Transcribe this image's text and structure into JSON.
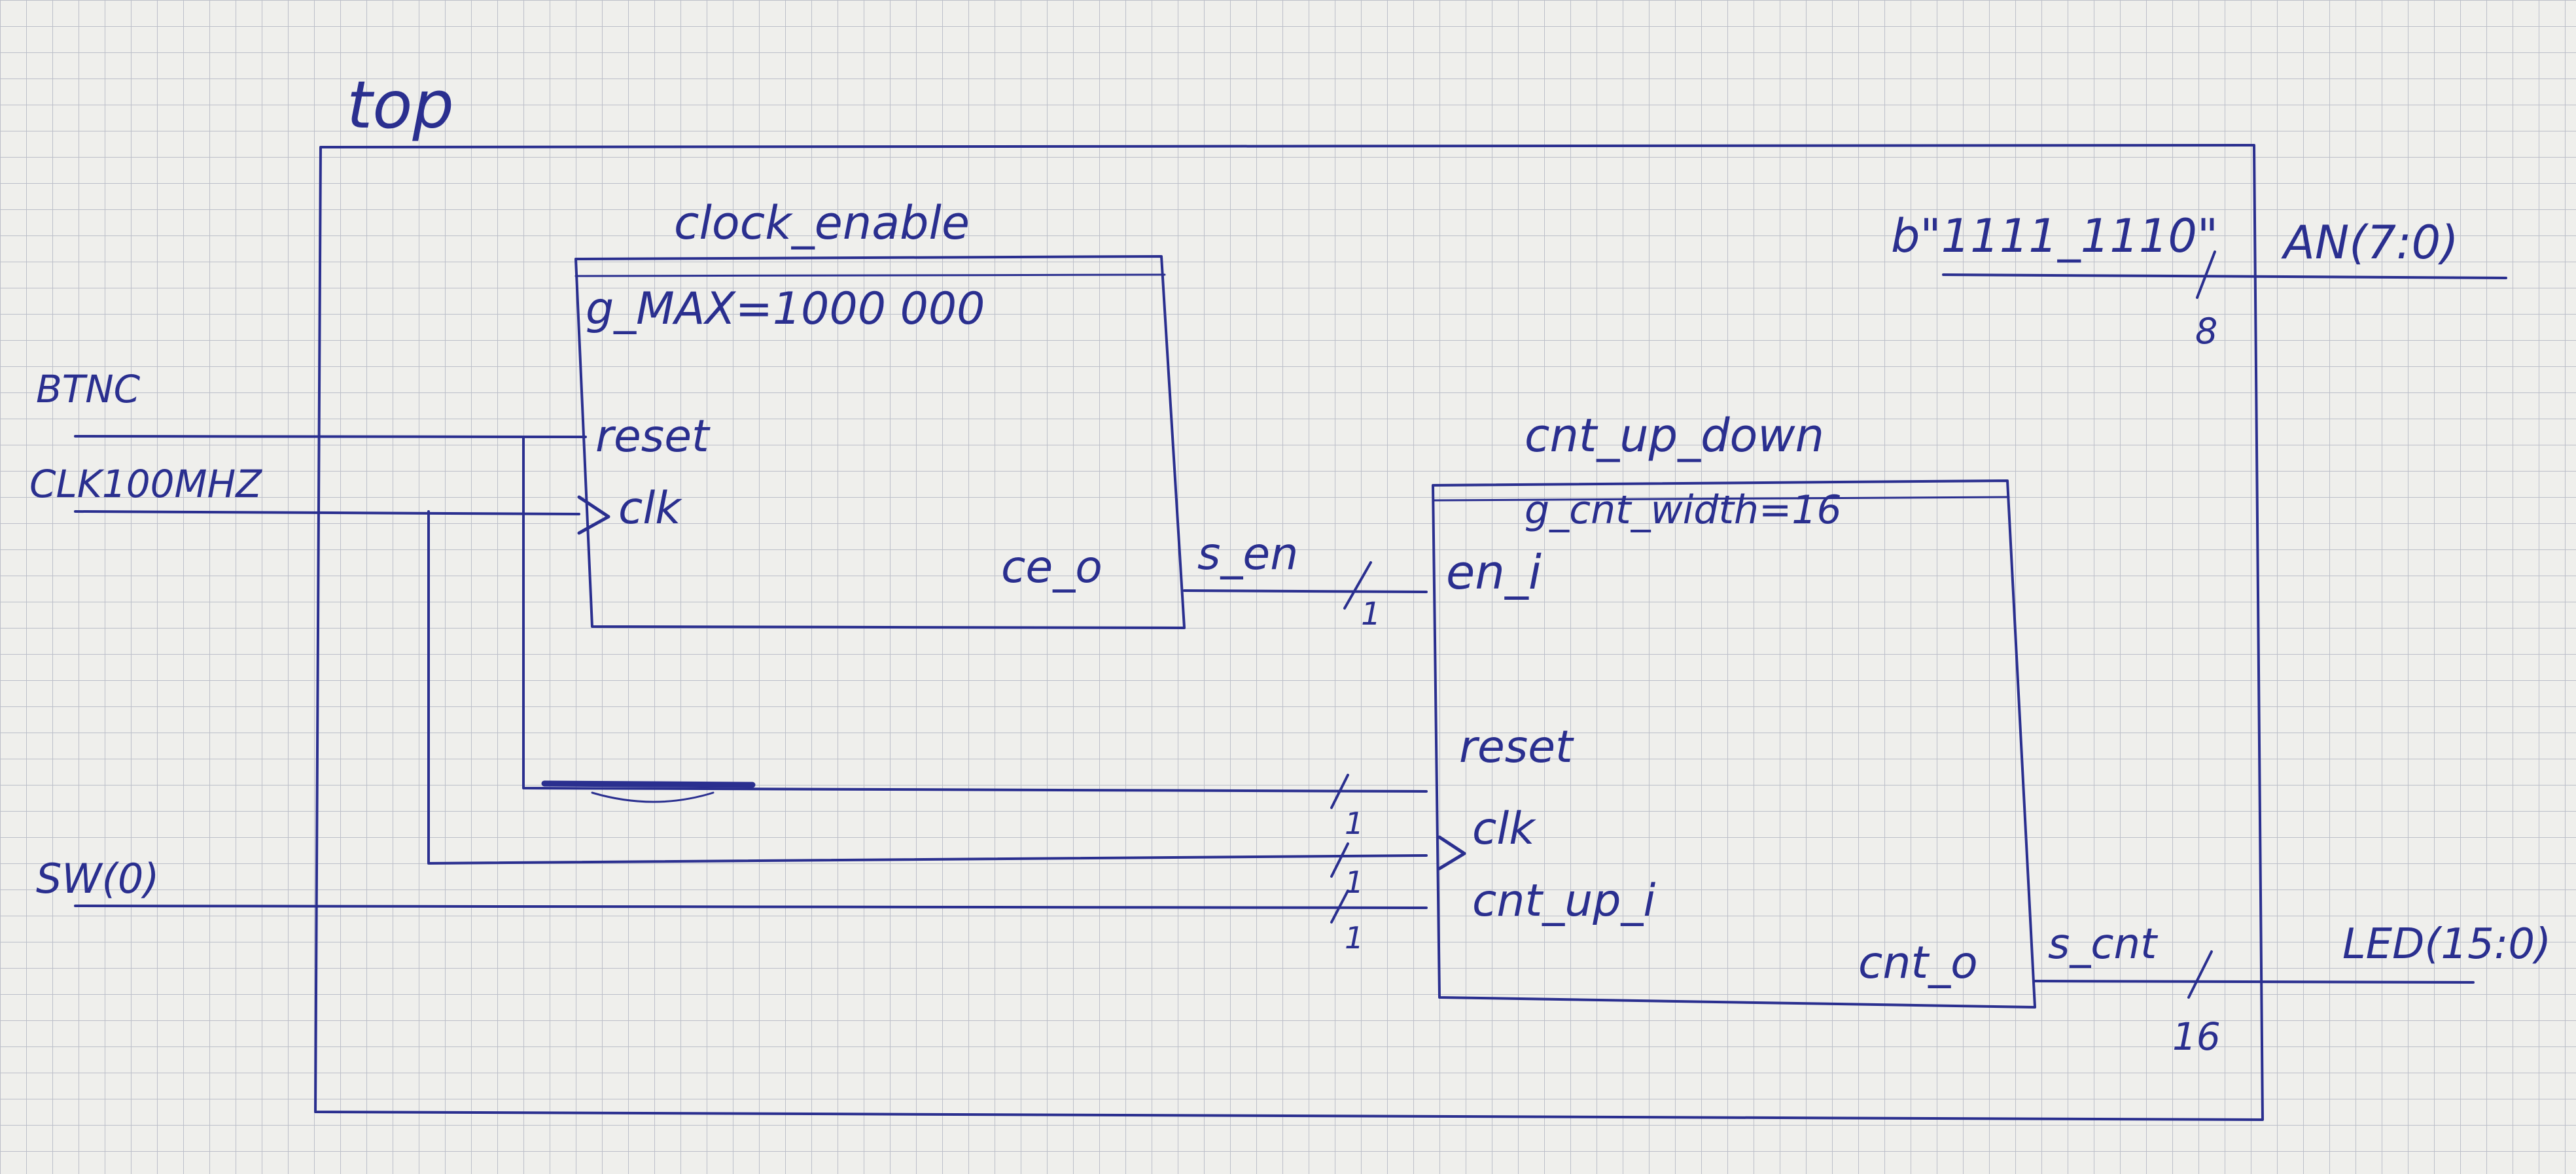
{
  "top": {
    "title": "top"
  },
  "clock_enable": {
    "name": "clock_enable",
    "generic": "g_MAX=1000 000",
    "ports": {
      "reset": "reset",
      "clk": "clk",
      "ce_o": "ce_o"
    }
  },
  "counter": {
    "name": "cnt_up_down",
    "generic": "g_cnt_width=16",
    "ports": {
      "en_i": "en_i",
      "reset": "reset",
      "clk": "clk",
      "cnt_up_i": "cnt_up_i",
      "cnt_o": "cnt_o"
    }
  },
  "inputs": {
    "btnc": "BTNC",
    "clk": "CLK100MHZ",
    "sw": "SW(0)"
  },
  "outputs": {
    "an": "AN(7:0)",
    "led": "LED(15:0)"
  },
  "constants": {
    "an_value": "b\"1111_1110\""
  },
  "signals": {
    "s_en": "s_en",
    "s_cnt": "s_cnt"
  },
  "bus_widths": {
    "an": "8",
    "led": "16",
    "s_en": "1",
    "reset": "1",
    "clk": "1",
    "cnt_up": "1"
  },
  "colors": {
    "ink": "#2a2f8f",
    "paper": "#efefec",
    "grid": "#b9bcc6"
  }
}
